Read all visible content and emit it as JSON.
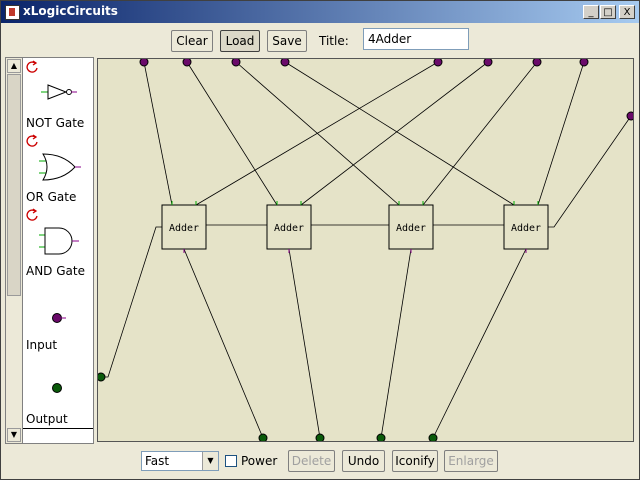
{
  "window": {
    "title": "xLogicCircuits",
    "minimize": "_",
    "maximize": "□",
    "close": "X"
  },
  "toolbar": {
    "clear_label": "Clear",
    "load_label": "Load",
    "save_label": "Save",
    "title_label": "Title:",
    "title_value": "4Adder"
  },
  "palette": {
    "items": [
      {
        "label": "NOT Gate",
        "icon": "not-gate-icon"
      },
      {
        "label": "OR Gate",
        "icon": "or-gate-icon"
      },
      {
        "label": "AND Gate",
        "icon": "and-gate-icon"
      },
      {
        "label": "Input",
        "icon": "input-node-icon"
      },
      {
        "label": "Output",
        "icon": "output-node-icon"
      }
    ]
  },
  "circuit": {
    "adder_label": "Adder",
    "adders": 4,
    "top_inputs": 8,
    "side_inputs": 1,
    "side_outputs": 1,
    "bottom_outputs": 4
  },
  "bottom": {
    "speed_value": "Fast",
    "power_label": "Power",
    "delete_label": "Delete",
    "undo_label": "Undo",
    "iconify_label": "Iconify",
    "enlarge_label": "Enlarge"
  },
  "colors": {
    "input": "#6a0a6a",
    "output": "#0a5a0a",
    "canvas": "#e5e3c8",
    "titlebar": "#0a246a"
  }
}
